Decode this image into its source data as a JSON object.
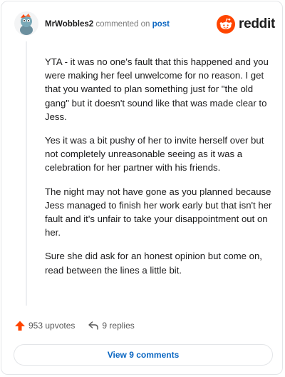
{
  "comment": {
    "username": "MrWobbles2",
    "action_text": "commented on",
    "post_link_text": "post",
    "paragraphs": [
      "YTA - it was no one's fault that this happened and you were making her feel unwelcome for no reason. I get that you wanted to plan something just for \"the old gang\" but it doesn't sound like that was made clear to Jess.",
      "Yes it was a bit pushy of her to invite herself over but not completely unreasonable seeing as it was a celebration for her partner with his friends.",
      "The night may not have gone as you planned because Jess managed to finish her work early but that isn't her fault and it's unfair to take your disappointment out on her.",
      "Sure she did ask for an honest opinion but come on, read between the lines a little bit."
    ]
  },
  "brand": {
    "logo_text": "reddit",
    "logo_icon": "reddit-alien-icon",
    "accent_color": "#ff4500"
  },
  "stats": {
    "upvotes_label": "953 upvotes",
    "upvote_icon": "upvote-arrow-icon",
    "replies_label": "9 replies",
    "reply_icon": "reply-arrow-icon"
  },
  "footer": {
    "view_comments_label": "View 9 comments",
    "link_color": "#0a66c2"
  }
}
